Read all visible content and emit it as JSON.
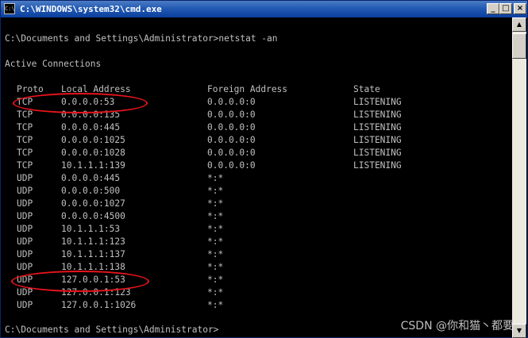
{
  "window": {
    "title": "C:\\WINDOWS\\system32\\cmd.exe",
    "icon": "cmd-icon",
    "buttons": {
      "minimize": "_",
      "maximize": "□",
      "close": "×"
    }
  },
  "console": {
    "prompt_command": "C:\\Documents and Settings\\Administrator>netstat -an",
    "heading": "Active Connections",
    "columns": [
      "Proto",
      "Local Address",
      "Foreign Address",
      "State"
    ],
    "rows": [
      [
        "TCP",
        "0.0.0.0:53",
        "0.0.0.0:0",
        "LISTENING"
      ],
      [
        "TCP",
        "0.0.0.0:135",
        "0.0.0.0:0",
        "LISTENING"
      ],
      [
        "TCP",
        "0.0.0.0:445",
        "0.0.0.0:0",
        "LISTENING"
      ],
      [
        "TCP",
        "0.0.0.0:1025",
        "0.0.0.0:0",
        "LISTENING"
      ],
      [
        "TCP",
        "0.0.0.0:1028",
        "0.0.0.0:0",
        "LISTENING"
      ],
      [
        "TCP",
        "10.1.1.1:139",
        "0.0.0.0:0",
        "LISTENING"
      ],
      [
        "UDP",
        "0.0.0.0:445",
        "*:*",
        ""
      ],
      [
        "UDP",
        "0.0.0.0:500",
        "*:*",
        ""
      ],
      [
        "UDP",
        "0.0.0.0:1027",
        "*:*",
        ""
      ],
      [
        "UDP",
        "0.0.0.0:4500",
        "*:*",
        ""
      ],
      [
        "UDP",
        "10.1.1.1:53",
        "*:*",
        ""
      ],
      [
        "UDP",
        "10.1.1.1:123",
        "*:*",
        ""
      ],
      [
        "UDP",
        "10.1.1.1:137",
        "*:*",
        ""
      ],
      [
        "UDP",
        "10.1.1.1:138",
        "*:*",
        ""
      ],
      [
        "UDP",
        "127.0.0.1:53",
        "*:*",
        ""
      ],
      [
        "UDP",
        "127.0.0.1:123",
        "*:*",
        ""
      ],
      [
        "UDP",
        "127.0.0.1:1026",
        "*:*",
        ""
      ]
    ],
    "final_prompt": "C:\\Documents and Settings\\Administrator>"
  },
  "annotations": {
    "highlight_color": "#e8141c",
    "highlighted_rows": [
      0,
      14
    ]
  },
  "watermark": "CSDN @你和猫丶都要"
}
